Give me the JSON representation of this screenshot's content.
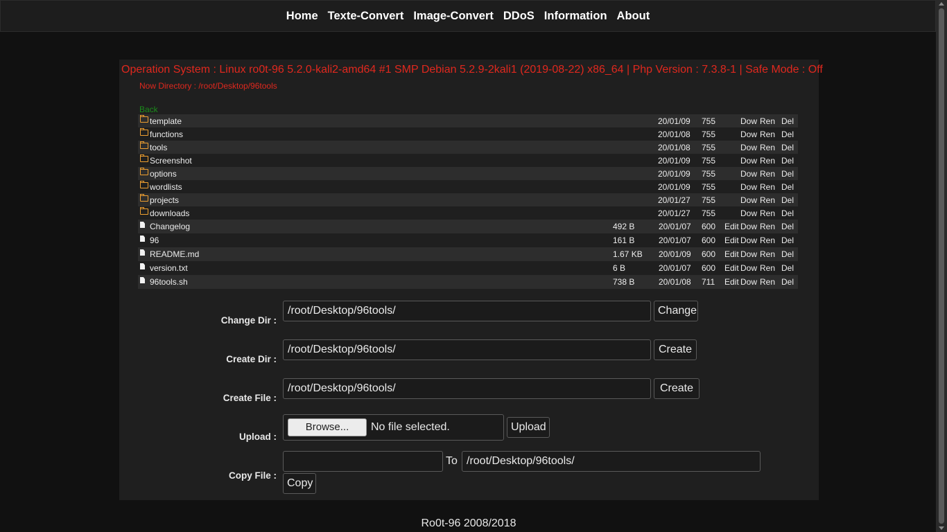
{
  "nav": {
    "items": [
      "Home",
      "Texte-Convert",
      "Image-Convert",
      "DDoS",
      "Information",
      "About"
    ]
  },
  "sysinfo": "Operation System : Linux ro0t-96 5.2.0-kali2-amd64 #1 SMP Debian 5.2.9-2kali1 (2019-08-22) x86_64 | Php Version : 7.3.8-1 | Safe Mode : Off",
  "now_directory": "Now Directory : /root/Desktop/96tools",
  "back_label": "Back",
  "actions": {
    "edit": "Edit",
    "download": "Dow",
    "rename": "Ren",
    "delete": "Del"
  },
  "folders": [
    {
      "name": "template",
      "date": "20/01/09",
      "perm": "755"
    },
    {
      "name": "functions",
      "date": "20/01/08",
      "perm": "755"
    },
    {
      "name": "tools",
      "date": "20/01/08",
      "perm": "755"
    },
    {
      "name": "Screenshot",
      "date": "20/01/09",
      "perm": "755"
    },
    {
      "name": "options",
      "date": "20/01/09",
      "perm": "755"
    },
    {
      "name": "wordlists",
      "date": "20/01/09",
      "perm": "755"
    },
    {
      "name": "projects",
      "date": "20/01/27",
      "perm": "755"
    },
    {
      "name": "downloads",
      "date": "20/01/27",
      "perm": "755"
    }
  ],
  "files": [
    {
      "name": "Changelog",
      "size": "492 B",
      "date": "20/01/07",
      "perm": "600"
    },
    {
      "name": "96",
      "size": "161 B",
      "date": "20/01/07",
      "perm": "600"
    },
    {
      "name": "README.md",
      "size": "1.67 KB",
      "date": "20/01/09",
      "perm": "600"
    },
    {
      "name": "version.txt",
      "size": "6 B",
      "date": "20/01/07",
      "perm": "600"
    },
    {
      "name": "96tools.sh",
      "size": "738 B",
      "date": "20/01/08",
      "perm": "711"
    }
  ],
  "forms": {
    "change_dir": {
      "label": "Change Dir :",
      "value": "/root/Desktop/96tools/",
      "button": "Change"
    },
    "create_dir": {
      "label": "Create Dir :",
      "value": "/root/Desktop/96tools/",
      "button": "Create"
    },
    "create_file": {
      "label": "Create File :",
      "value": "/root/Desktop/96tools/",
      "button": "Create"
    },
    "upload": {
      "label": "Upload :",
      "browse": "Browse...",
      "status": "No file selected.",
      "button": "Upload"
    },
    "copy_file": {
      "label": "Copy File :",
      "source": "",
      "to": "To",
      "dest": "/root/Desktop/96tools/",
      "button": "Copy"
    }
  },
  "footer": "Ro0t-96 2008/2018",
  "colors": {
    "accent_red": "#e0281e",
    "back_green": "#1b8c1b",
    "folder_orange": "#f0a030"
  }
}
